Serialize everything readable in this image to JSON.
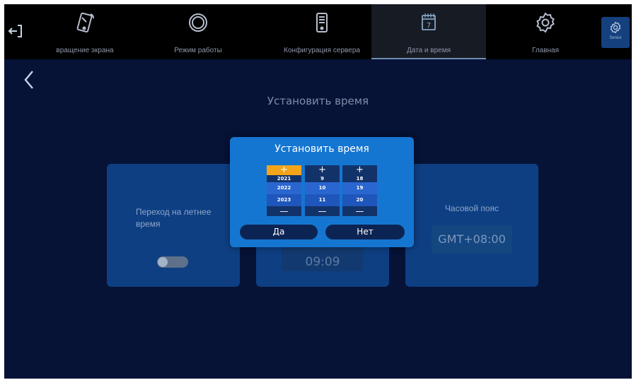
{
  "nav": {
    "items": [
      {
        "label": "вращение экрана",
        "icon": "phone-rotate-icon"
      },
      {
        "label": "Режим работы",
        "icon": "ring-icon"
      },
      {
        "label": "Конфигурация сервера",
        "icon": "server-icon"
      },
      {
        "label": "Дата и время",
        "icon": "calendar-icon",
        "active": true,
        "icon_text": "7"
      },
      {
        "label": "Главная",
        "icon": "gear-icon"
      }
    ],
    "settings_chip_label": "Senior"
  },
  "page": {
    "title": "Установить время"
  },
  "cards": {
    "dst": {
      "label": "Переход на летнее время",
      "enabled": false
    },
    "time": {
      "value": "09:09"
    },
    "timezone": {
      "label": "Часовой пояс",
      "value": "GMT+08:00"
    }
  },
  "dialog": {
    "title": "Установить время",
    "increment_symbol": "+",
    "decrement_symbol": "—",
    "columns": {
      "year": {
        "values": [
          "2021",
          "2022",
          "2023"
        ]
      },
      "month": {
        "values": [
          "9",
          "10",
          "11"
        ]
      },
      "day": {
        "values": [
          "18",
          "19",
          "20"
        ]
      }
    },
    "ok_label": "Да",
    "cancel_label": "Нет"
  },
  "colors": {
    "background": "#061236",
    "card": "#0e3f83",
    "dialog": "#1576d2",
    "highlight": "#f3a419",
    "nav_active_underline": "#6d8fb3"
  }
}
